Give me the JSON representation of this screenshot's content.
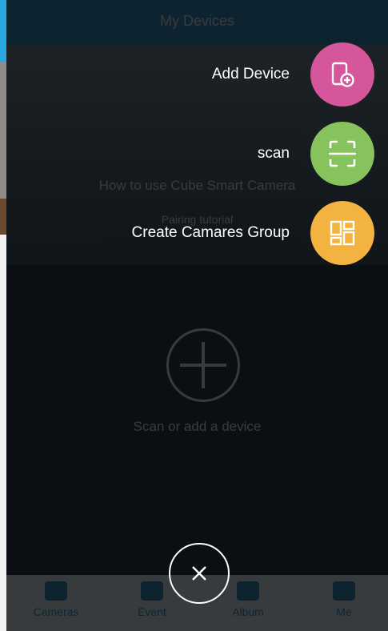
{
  "background": {
    "title": "My Devices",
    "banner_text": "How to use Cube Smart Camera",
    "banner_sub": "Pairing tutorial",
    "add_text": "Scan or add a device",
    "tabs": [
      "Cameras",
      "Event",
      "Album",
      "Me"
    ]
  },
  "menu": {
    "items": [
      {
        "label": "Add Device",
        "icon": "add-device-icon",
        "color": "#d6569b"
      },
      {
        "label": "scan",
        "icon": "scan-icon",
        "color": "#86c35c"
      },
      {
        "label": "Create Camares Group",
        "icon": "group-icon",
        "color": "#f3b340"
      }
    ],
    "close_icon": "close-icon"
  }
}
